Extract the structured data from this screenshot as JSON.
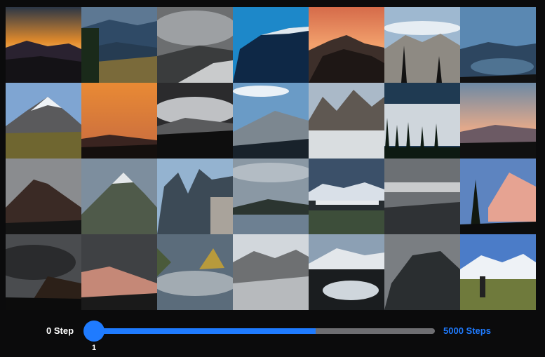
{
  "gallery": {
    "columns": 7,
    "rows": 4,
    "tiles": [
      "sunset-mountain-silhouette",
      "valley-ridge-dusk",
      "cloudy-snow-slope",
      "blue-sky-cliff",
      "orange-sky-peaks",
      "cloud-valley-pine",
      "lake-haze-mountains",
      "snowy-peak-meadow",
      "orange-haze-range",
      "misty-forest-ridge",
      "snowy-ridge-sky",
      "lake-crags",
      "stormy-forest",
      "pink-sky-range",
      "dark-peak-mist",
      "snowy-spire",
      "crag-towers",
      "calm-lake-hills",
      "mountain-town",
      "grey-mist-layers",
      "pine-alpenglow",
      "dark-storm-peak",
      "rosy-cliff-mist",
      "green-spire-clouds",
      "snowy-mountain-range",
      "lake-snow-pines",
      "mist-peak-shadow",
      "alpine-meadow-range"
    ]
  },
  "slider": {
    "min_label": "0 Step",
    "max_label": "5000 Steps",
    "value_label": "1",
    "fill_fraction": 0.65
  },
  "colors": {
    "accent": "#1f7bff",
    "track": "#6e6e72",
    "background": "#0b0b0c"
  }
}
